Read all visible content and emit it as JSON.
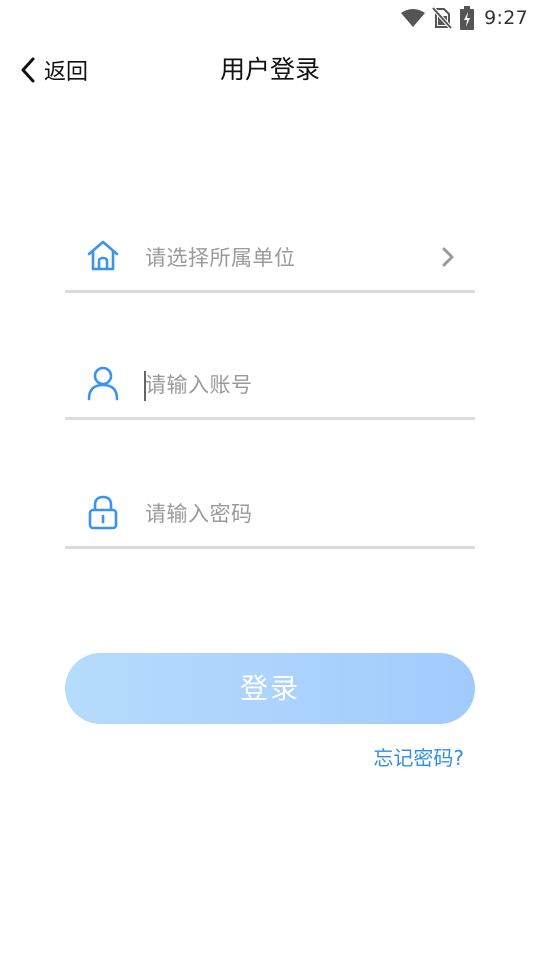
{
  "status_bar": {
    "time": "9:27",
    "icons": [
      "wifi-icon",
      "no-sim-icon",
      "battery-charging-icon"
    ]
  },
  "nav": {
    "back_label": "返回",
    "title": "用户登录"
  },
  "form": {
    "organization": {
      "placeholder": "请选择所属单位",
      "icon": "home-icon"
    },
    "account": {
      "placeholder": "请输入账号",
      "value": "",
      "icon": "user-icon"
    },
    "password": {
      "placeholder": "请输入密码",
      "value": "",
      "icon": "lock-icon"
    },
    "login_label": "登录",
    "forgot_label": "忘记密码?"
  },
  "colors": {
    "accent": "#3a94ef",
    "button_start": "#b5dcfb",
    "button_end": "#a2cbfd",
    "link": "#2f8fe6",
    "placeholder": "#9a9a9a",
    "divider": "#dcdcdc"
  }
}
